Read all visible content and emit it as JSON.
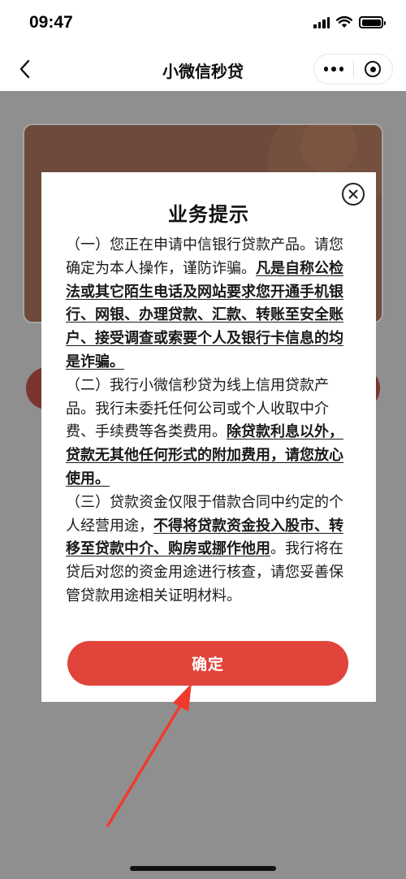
{
  "status_bar": {
    "time": "09:47"
  },
  "nav": {
    "title": "小微信秒贷"
  },
  "modal": {
    "title": "业务提示",
    "paragraphs": [
      {
        "normal": "（一）您正在申请中信银行贷款产品。请您确定为本人操作，谨防诈骗。",
        "emph": "凡是自称公检法或其它陌生电话及网站要求您开通手机银行、网银、办理贷款、汇款、转账至安全账户、接受调查或索要个人及银行卡信息的均是诈骗。",
        "tail": ""
      },
      {
        "normal": "（二）我行小微信秒贷为线上信用贷款产品。我行未委托任何公司或个人收取中介费、手续费等各类费用。",
        "emph": "除贷款利息以外，贷款无其他任何形式的附加费用，请您放心使用。",
        "tail": ""
      },
      {
        "normal": "（三）贷款资金仅限于借款合同中约定的个人经营用途，",
        "emph": "不得将贷款资金投入股市、转移至贷款中介、购房或挪作他用",
        "tail": "。我行将在贷后对您的资金用途进行核查，请您妥善保管贷款用途相关证明材料。"
      }
    ],
    "confirm_label": "确定"
  },
  "colors": {
    "accent": "#e0443b",
    "annotation_arrow": "#f03a2e"
  }
}
